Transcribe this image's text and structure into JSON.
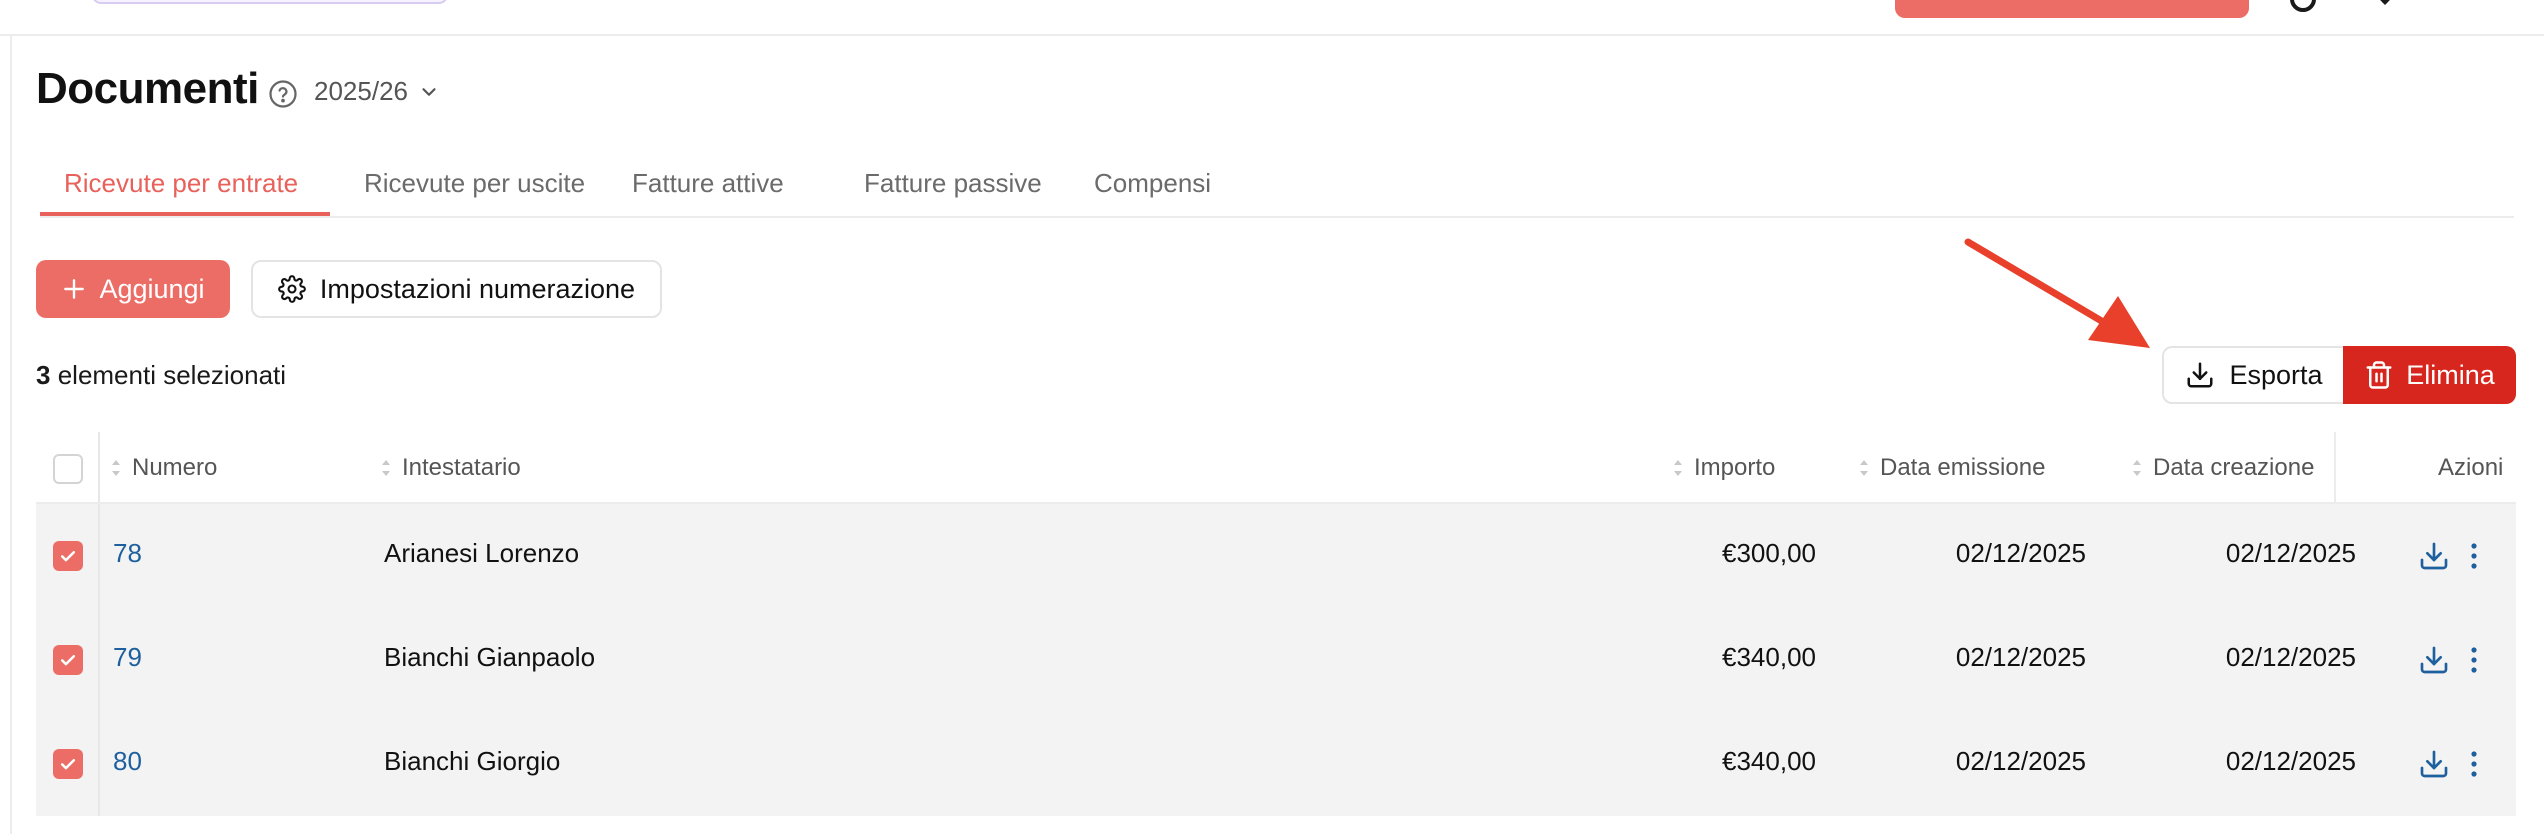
{
  "page": {
    "title": "Documenti",
    "year": "2025/26"
  },
  "tabs": [
    {
      "label": "Ricevute per entrate",
      "active": true
    },
    {
      "label": "Ricevute per uscite",
      "active": false
    },
    {
      "label": "Fatture attive",
      "active": false
    },
    {
      "label": "Fatture passive",
      "active": false
    },
    {
      "label": "Compensi",
      "active": false
    }
  ],
  "toolbar": {
    "add_label": "Aggiungi",
    "settings_label": "Impostazioni numerazione"
  },
  "selection": {
    "count": "3",
    "text": "elementi selezionati"
  },
  "bulk_actions": {
    "export_label": "Esporta",
    "delete_label": "Elimina"
  },
  "table": {
    "headers": {
      "numero": "Numero",
      "intestatario": "Intestatario",
      "importo": "Importo",
      "data_emissione": "Data emissione",
      "data_creazione": "Data creazione",
      "azioni": "Azioni"
    },
    "rows": [
      {
        "numero": "78",
        "intestatario": "Arianesi Lorenzo",
        "importo": "€300,00",
        "data_emissione": "02/12/2025",
        "data_creazione": "02/12/2025",
        "selected": true
      },
      {
        "numero": "79",
        "intestatario": "Bianchi Gianpaolo",
        "importo": "€340,00",
        "data_emissione": "02/12/2025",
        "data_creazione": "02/12/2025",
        "selected": true
      },
      {
        "numero": "80",
        "intestatario": "Bianchi Giorgio",
        "importo": "€340,00",
        "data_emissione": "02/12/2025",
        "data_creazione": "02/12/2025",
        "selected": true
      }
    ]
  },
  "colors": {
    "accent": "#ec6c66",
    "active_tab": "#e8615b",
    "danger": "#d7261e",
    "link": "#1e5f9e",
    "annotation_arrow": "#e8402a"
  },
  "icons": {
    "help": "help-circle-icon",
    "chevron": "chevron-down-icon",
    "add": "plus-icon",
    "settings": "gear-icon",
    "export": "download-icon",
    "delete": "trash-icon",
    "row_download": "download-icon",
    "row_more": "more-vertical-icon",
    "annotation": "annotation-arrow-icon"
  }
}
